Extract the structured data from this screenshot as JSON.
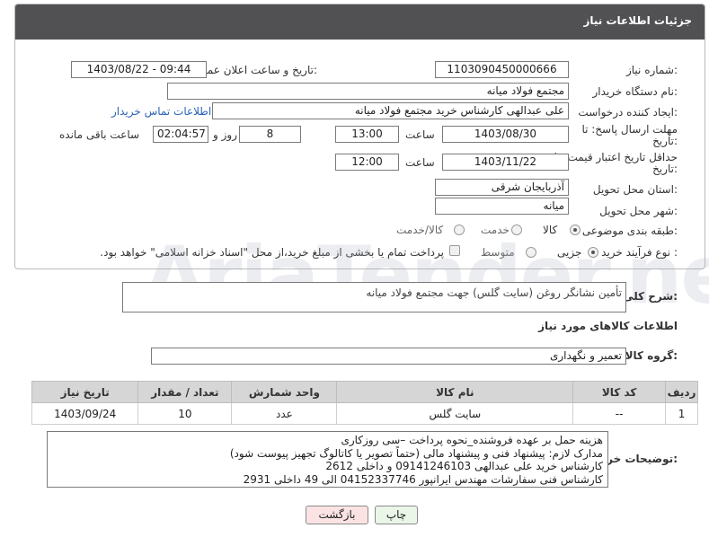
{
  "header": {
    "title": "جزئیات اطلاعات نیاز"
  },
  "fields": {
    "need_number_label": "شماره نیاز:",
    "need_number": "1103090450000666",
    "announce_label": "تاریخ و ساعت اعلان عمومی:",
    "announce_value": "1403/08/22 - 09:44",
    "buyer_org_label": "نام دستگاه خریدار:",
    "buyer_org": "مجتمع فولاد میانه",
    "creator_label": "ایجاد کننده درخواست:",
    "creator": "علی عبدالهی کارشناس خرید مجتمع فولاد میانه",
    "contact_link": "اطلاعات تماس خریدار",
    "reply_deadline_label_1": "مهلت ارسال پاسخ: تا",
    "reply_deadline_label_2": "تاریخ:",
    "reply_date": "1403/08/30",
    "time_label": "ساعت",
    "reply_time": "13:00",
    "days_value": "8",
    "days_label": "روز و",
    "remaining_time": "02:04:57",
    "remaining_label": "ساعت باقی مانده",
    "price_validity_label_1": "حداقل تاریخ اعتبار قیمت: تا",
    "price_validity_label_2": "تاریخ:",
    "price_date": "1403/11/22",
    "price_time": "12:00",
    "province_label": "استان محل تحویل:",
    "province": "آذربایجان شرقی",
    "city_label": "شهر محل تحویل:",
    "city": "میانه",
    "category_label": "طبقه بندی موضوعی:",
    "category_options": [
      "کالا",
      "خدمت",
      "کالا/خدمت"
    ],
    "purchase_type_label": "نوع فرآیند خرید :",
    "purchase_options": [
      "جزیی",
      "متوسط"
    ],
    "payment_note": "پرداخت تمام یا بخشی از مبلغ خرید،از محل \"اسناد خزانه اسلامی\" خواهد بود."
  },
  "summary": {
    "label": "شرح کلی نیاز:",
    "text": "تأمین نشانگر روغن (سایت گلس) جهت مجتمع فولاد میانه"
  },
  "goods_info_title": "اطلاعات کالاهای مورد نیاز",
  "goods_group": {
    "label": "گروه کالا:",
    "value": "تعمیر و نگهداری"
  },
  "table": {
    "headers": [
      "ردیف",
      "کد کالا",
      "نام کالا",
      "واحد شمارش",
      "تعداد / مقدار",
      "تاریخ نیاز"
    ],
    "rows": [
      [
        "1",
        "--",
        "سایت گلس",
        "عدد",
        "10",
        "1403/09/24"
      ]
    ]
  },
  "buyer_notes": {
    "label": "توضیحات خریدار:",
    "lines": [
      "هزینه حمل بر عهده فروشنده_نحوه پرداخت –سی روزکاری",
      "مدارک لازم: پیشنهاد فنی و پیشنهاد مالی (حتماً تصویر یا کاتالوگ تجهیز پیوست شود)",
      "کارشناس خرید علی عبدالهی 09141246103 و داخلی 2612",
      "کارشناس فنی سفارشات مهندس ایرانپور 04152337746 الی 49 داخلی 2931"
    ]
  },
  "buttons": {
    "print": "چاپ",
    "back": "بازگشت"
  },
  "watermark": "AriaTender.neT",
  "colors": {
    "header_bg": "#515154",
    "link": "#2a62b8",
    "back_button_bg": "#fbe3e3",
    "print_button_bg": "#eaf6e8"
  }
}
